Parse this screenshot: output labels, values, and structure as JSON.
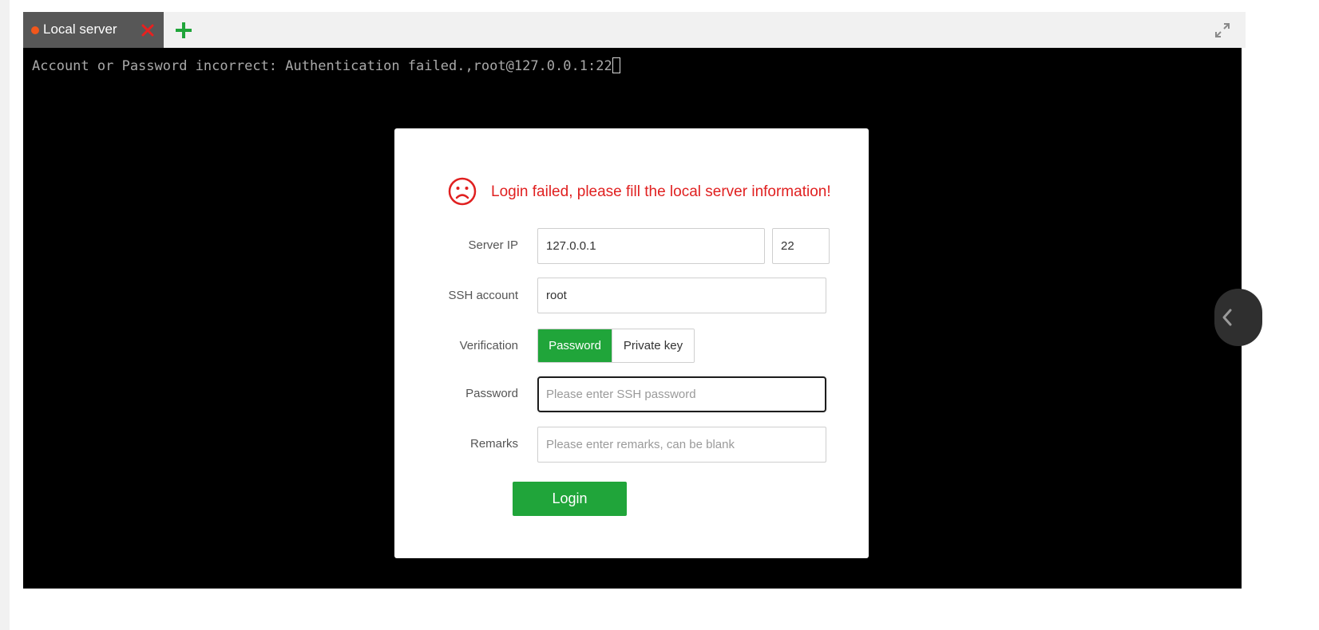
{
  "colors": {
    "accent_green": "#20a53a",
    "error_red": "#e02020",
    "tab_dot": "#f2571c",
    "terminal_bg": "#000000",
    "terminal_text": "#a9a9a9"
  },
  "tabs": [
    {
      "label": "Local server",
      "active": true,
      "status_icon": "status-dot-icon",
      "close_icon": "close-icon"
    }
  ],
  "toolbar": {
    "add_tab_icon": "plus-icon",
    "fullscreen_icon": "expand-icon"
  },
  "terminal": {
    "output_line": "Account or Password incorrect: Authentication failed.,root@127.0.0.1:22"
  },
  "side_panel_toggle": {
    "icon": "chevron-left-icon"
  },
  "login_dialog": {
    "error_icon": "sad-face-icon",
    "error_message": "Login failed, please fill the local server information!",
    "server_ip": {
      "label": "Server IP",
      "value": "127.0.0.1",
      "port": "22"
    },
    "ssh_account": {
      "label": "SSH account",
      "value": "root"
    },
    "verification": {
      "label": "Verification",
      "options": [
        "Password",
        "Private key"
      ],
      "selected": "Password"
    },
    "password": {
      "label": "Password",
      "value": "",
      "placeholder": "Please enter SSH password"
    },
    "remarks": {
      "label": "Remarks",
      "value": "",
      "placeholder": "Please enter remarks, can be blank"
    },
    "login_button": "Login"
  }
}
